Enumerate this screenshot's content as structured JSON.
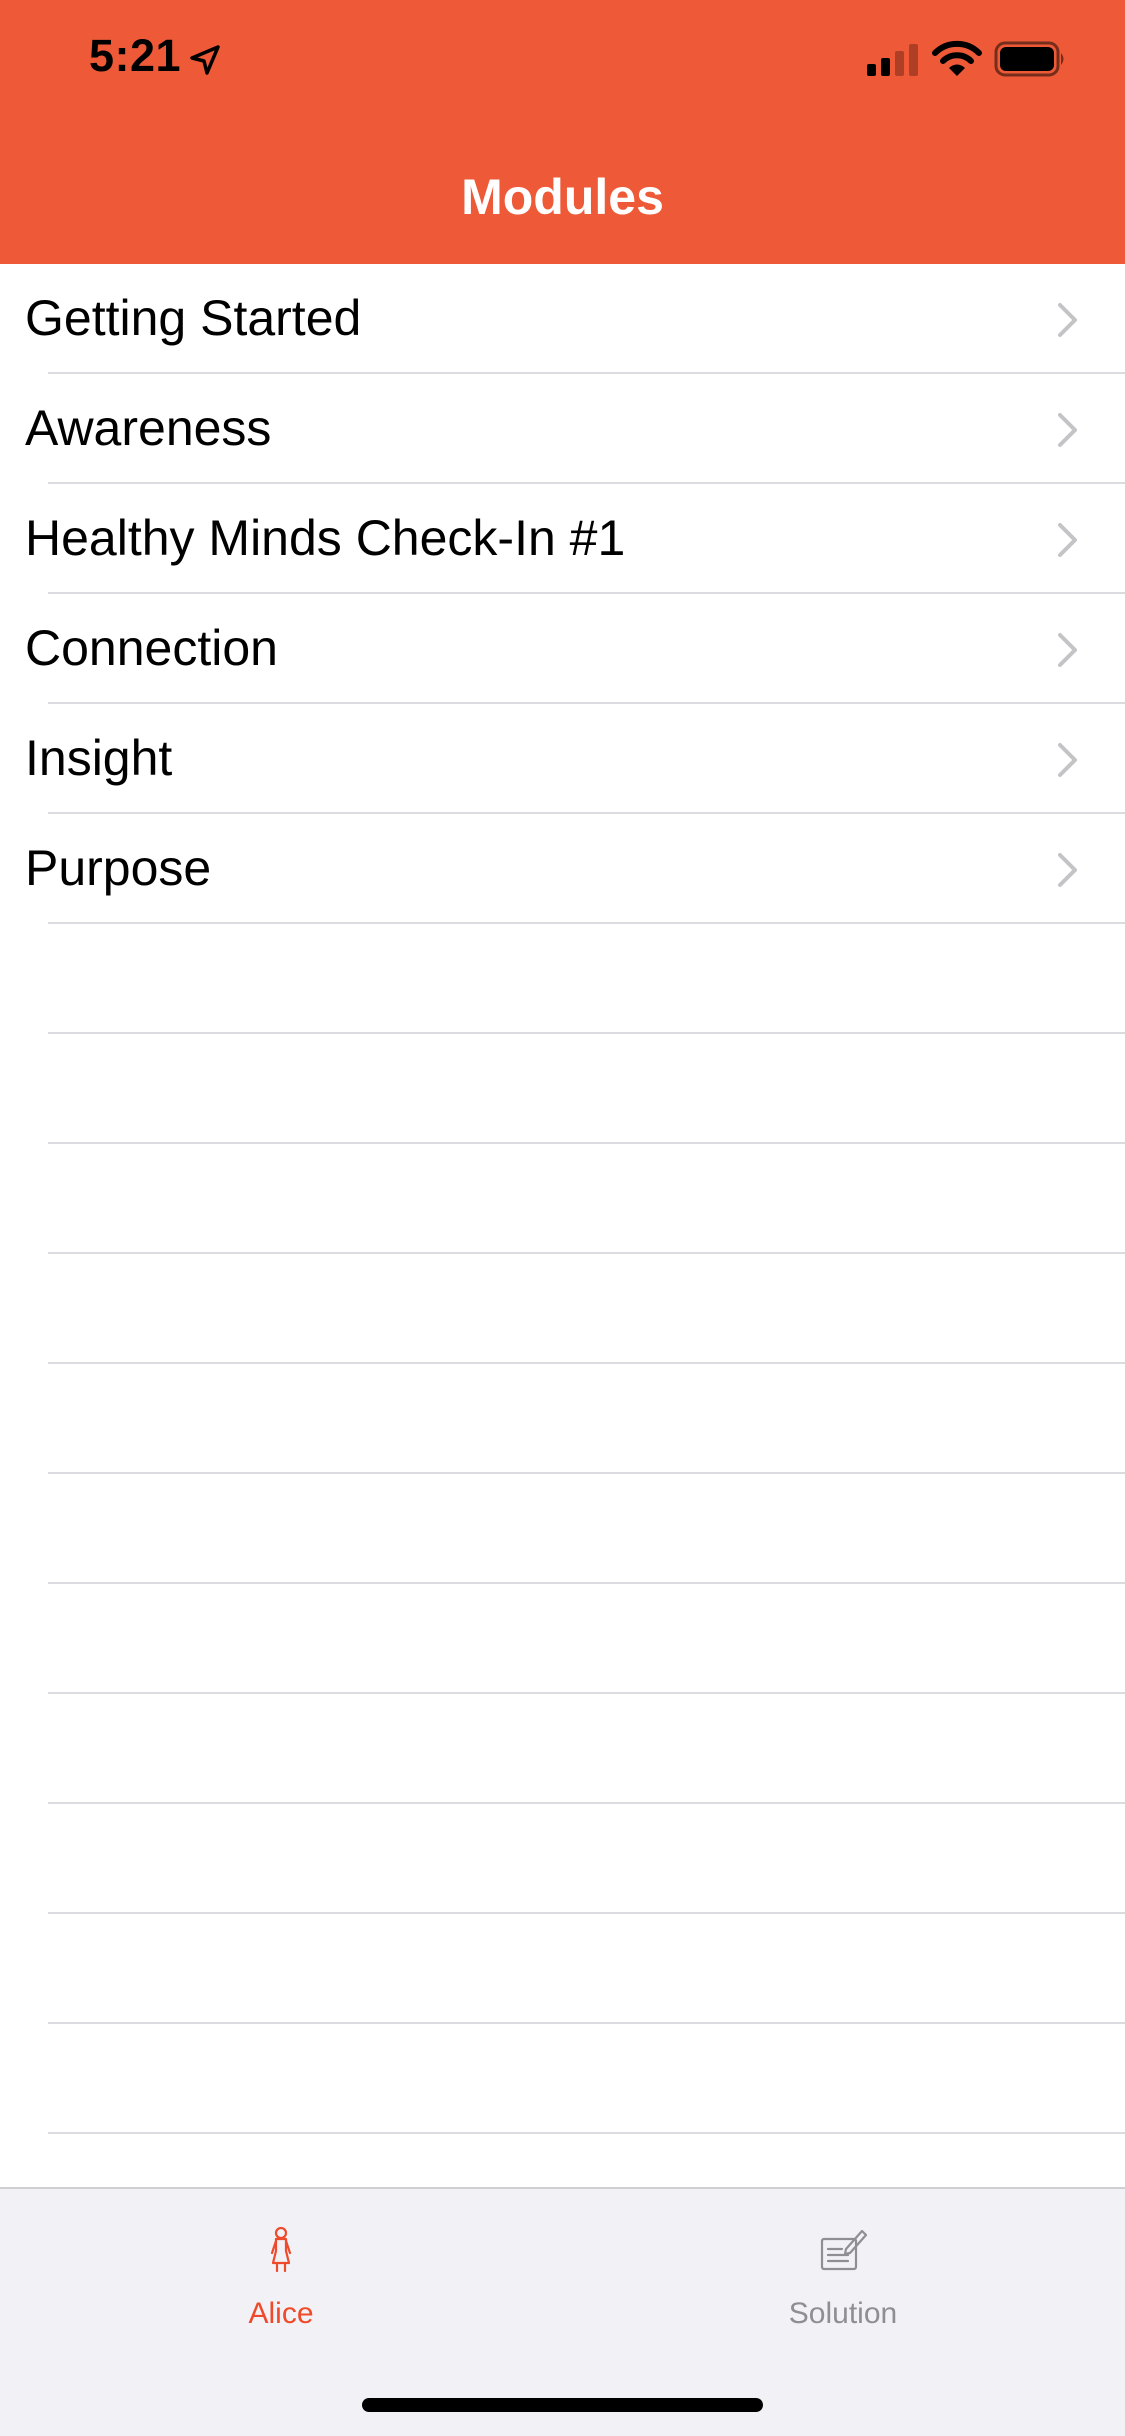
{
  "status_bar": {
    "time": "5:21"
  },
  "nav": {
    "title": "Modules"
  },
  "modules": [
    {
      "label": "Getting Started"
    },
    {
      "label": "Awareness"
    },
    {
      "label": "Healthy Minds Check-In #1"
    },
    {
      "label": "Connection"
    },
    {
      "label": "Insight"
    },
    {
      "label": "Purpose"
    }
  ],
  "tabbar": {
    "tabs": [
      {
        "label": "Alice",
        "icon": "person-icon",
        "selected": true
      },
      {
        "label": "Solution",
        "icon": "edit-note-icon",
        "selected": false
      }
    ]
  },
  "colors": {
    "accent": "#EE5A37",
    "tab_selected": "#EE4A2B",
    "tab_unselected": "#8e8e93"
  }
}
